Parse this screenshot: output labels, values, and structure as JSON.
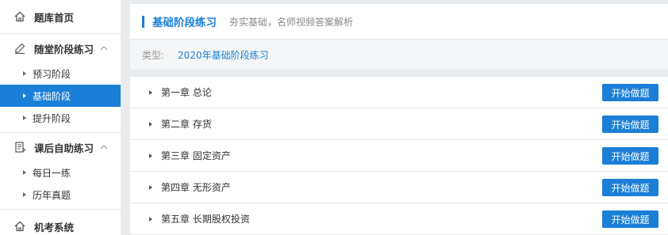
{
  "sidebar": {
    "home": {
      "label": "题库首页",
      "icon": "home-icon"
    },
    "groups": [
      {
        "label": "随堂阶段练习",
        "icon": "edit-icon",
        "items": [
          {
            "label": "预习阶段",
            "active": false
          },
          {
            "label": "基础阶段",
            "active": true
          },
          {
            "label": "提升阶段",
            "active": false
          }
        ]
      },
      {
        "label": "课后自助练习",
        "icon": "notes-icon",
        "items": [
          {
            "label": "每日一练",
            "active": false
          },
          {
            "label": "历年真题",
            "active": false
          }
        ]
      }
    ],
    "exam": {
      "label": "机考系统",
      "icon": "home-icon"
    }
  },
  "header": {
    "title": "基础阶段练习",
    "subtitle": "夯实基础，名师视频答案解析"
  },
  "type_bar": {
    "label": "类型:",
    "value": "2020年基础阶段练习"
  },
  "chapters": [
    {
      "label": "第一章 总论",
      "button": "开始做题"
    },
    {
      "label": "第二章 存货",
      "button": "开始做题"
    },
    {
      "label": "第三章 固定资产",
      "button": "开始做题"
    },
    {
      "label": "第四章 无形资产",
      "button": "开始做题"
    },
    {
      "label": "第五章 长期股权投资",
      "button": "开始做题"
    }
  ],
  "colors": {
    "accent": "#1a7fd6",
    "page_bg": "#e9ecef"
  }
}
